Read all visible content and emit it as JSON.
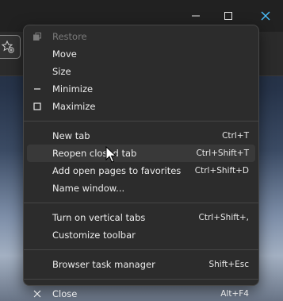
{
  "menu": {
    "system_items": [
      {
        "label": "Restore",
        "shortcut": "",
        "icon": "restore-icon",
        "disabled": true
      },
      {
        "label": "Move",
        "shortcut": "",
        "icon": "",
        "disabled": false
      },
      {
        "label": "Size",
        "shortcut": "",
        "icon": "",
        "disabled": false
      },
      {
        "label": "Minimize",
        "shortcut": "",
        "icon": "minimize-icon",
        "disabled": false
      },
      {
        "label": "Maximize",
        "shortcut": "",
        "icon": "maximize-icon",
        "disabled": false
      }
    ],
    "tab_items": [
      {
        "label": "New tab",
        "shortcut": "Ctrl+T"
      },
      {
        "label": "Reopen closed tab",
        "shortcut": "Ctrl+Shift+T",
        "highlighted": true
      },
      {
        "label": "Add open pages to favorites",
        "shortcut": "Ctrl+Shift+D"
      },
      {
        "label": "Name window...",
        "shortcut": ""
      }
    ],
    "toolbar_items": [
      {
        "label": "Turn on vertical tabs",
        "shortcut": "Ctrl+Shift+,"
      },
      {
        "label": "Customize toolbar",
        "shortcut": ""
      }
    ],
    "manager_items": [
      {
        "label": "Browser task manager",
        "shortcut": "Shift+Esc"
      }
    ],
    "close_item": {
      "label": "Close",
      "shortcut": "Alt+F4",
      "icon": "close-icon"
    }
  },
  "colors": {
    "menu_bg": "#2c2c2c",
    "highlight": "#393939",
    "text": "#ececec",
    "disabled_text": "#7a7a7a",
    "close_button_accent": "#4cc2ff"
  }
}
